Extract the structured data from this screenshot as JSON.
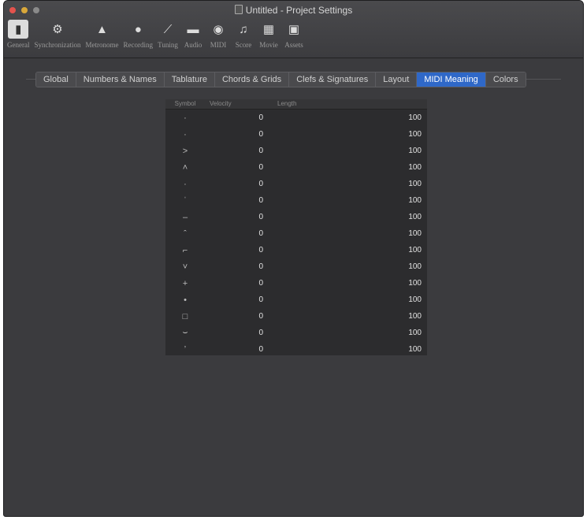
{
  "window": {
    "title": "Untitled - Project Settings"
  },
  "toolbar": {
    "items": [
      {
        "label": "General",
        "icon": "general-icon",
        "glyph": "▮"
      },
      {
        "label": "Synchronization",
        "icon": "synchronization-icon",
        "glyph": "⚙"
      },
      {
        "label": "Metronome",
        "icon": "metronome-icon",
        "glyph": "▲"
      },
      {
        "label": "Recording",
        "icon": "recording-icon",
        "glyph": "●"
      },
      {
        "label": "Tuning",
        "icon": "tuning-icon",
        "glyph": "⟋"
      },
      {
        "label": "Audio",
        "icon": "audio-icon",
        "glyph": "▬"
      },
      {
        "label": "MIDI",
        "icon": "midi-icon",
        "glyph": "◉"
      },
      {
        "label": "Score",
        "icon": "score-icon",
        "glyph": "♫"
      },
      {
        "label": "Movie",
        "icon": "movie-icon",
        "glyph": "▦"
      },
      {
        "label": "Assets",
        "icon": "assets-icon",
        "glyph": "▣"
      }
    ]
  },
  "tabs": [
    {
      "label": "Global"
    },
    {
      "label": "Numbers & Names"
    },
    {
      "label": "Tablature"
    },
    {
      "label": "Chords & Grids"
    },
    {
      "label": "Clefs & Signatures"
    },
    {
      "label": "Layout"
    },
    {
      "label": "MIDI Meaning",
      "selected": true
    },
    {
      "label": "Colors"
    }
  ],
  "table": {
    "headers": {
      "symbol": "Symbol",
      "velocity": "Velocity",
      "length": "Length"
    },
    "rows": [
      {
        "symbol": "·",
        "velocity": "0",
        "length": "100"
      },
      {
        "symbol": "·",
        "velocity": "0",
        "length": "100"
      },
      {
        "symbol": ">",
        "velocity": "0",
        "length": "100"
      },
      {
        "symbol": "˄",
        "velocity": "0",
        "length": "100"
      },
      {
        "symbol": "·",
        "velocity": "0",
        "length": "100"
      },
      {
        "symbol": "ˈ",
        "velocity": "0",
        "length": "100"
      },
      {
        "symbol": "–",
        "velocity": "0",
        "length": "100"
      },
      {
        "symbol": "ˆ",
        "velocity": "0",
        "length": "100"
      },
      {
        "symbol": "⌐",
        "velocity": "0",
        "length": "100"
      },
      {
        "symbol": "˅",
        "velocity": "0",
        "length": "100"
      },
      {
        "symbol": "+",
        "velocity": "0",
        "length": "100"
      },
      {
        "symbol": "•",
        "velocity": "0",
        "length": "100"
      },
      {
        "symbol": "□",
        "velocity": "0",
        "length": "100"
      },
      {
        "symbol": "⌣",
        "velocity": "0",
        "length": "100"
      },
      {
        "symbol": "ʼ",
        "velocity": "0",
        "length": "100"
      }
    ]
  }
}
